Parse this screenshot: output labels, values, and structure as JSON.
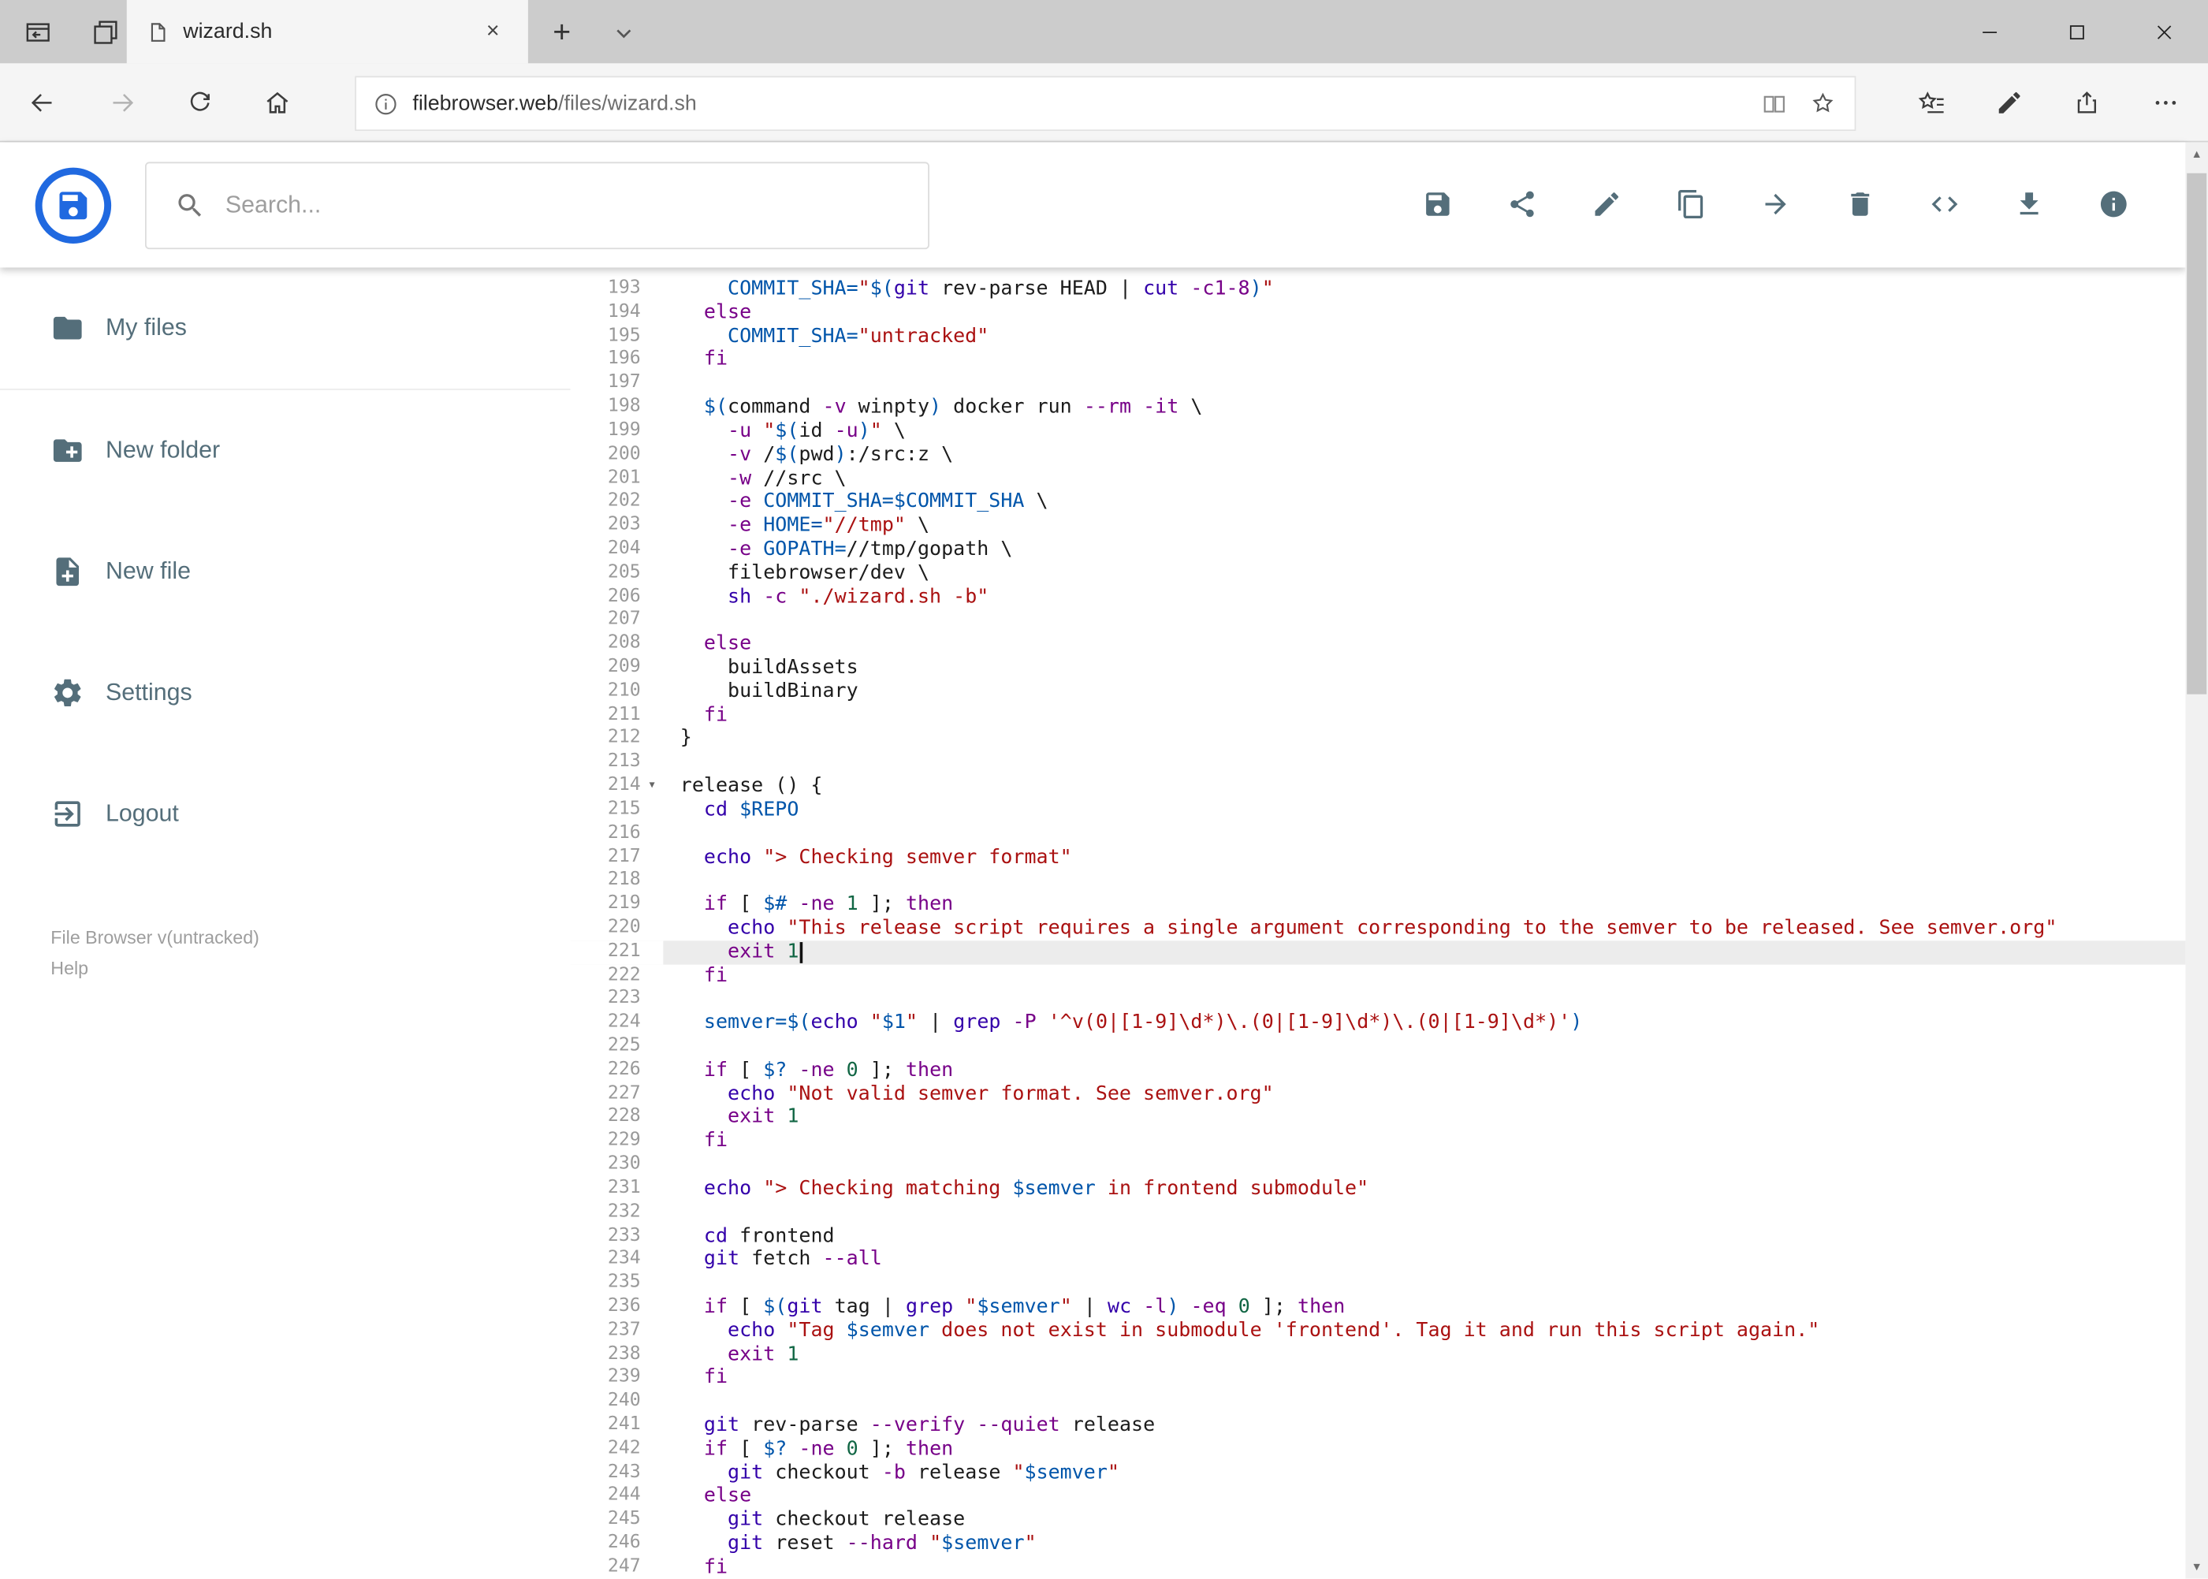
{
  "browser": {
    "tab": {
      "title": "wizard.sh"
    },
    "url": {
      "domain": "filebrowser.web",
      "path": "/files/wizard.sh"
    }
  },
  "header": {
    "search": {
      "placeholder": "Search..."
    },
    "actions": [
      "save-icon",
      "share-icon",
      "edit-icon",
      "copy-icon",
      "move-icon",
      "delete-icon",
      "code-icon",
      "download-icon",
      "info-icon"
    ]
  },
  "sidebar": {
    "items": [
      {
        "label": "My files",
        "icon": "folder-icon"
      },
      {
        "label": "New folder",
        "icon": "new-folder-icon"
      },
      {
        "label": "New file",
        "icon": "new-file-icon"
      },
      {
        "label": "Settings",
        "icon": "settings-gear-icon"
      },
      {
        "label": "Logout",
        "icon": "logout-icon"
      }
    ],
    "footer": {
      "version": "File Browser v(untracked)",
      "help": "Help"
    }
  },
  "colors": {
    "accent": "#2069e0",
    "icon": "#546e7a",
    "syntax": {
      "keyword": "#770088",
      "builtin": "#3300aa",
      "string": "#aa1111",
      "variable": "#0055aa",
      "number": "#116644"
    }
  },
  "editor": {
    "first_line": 193,
    "last_line": 247,
    "active_line": 221,
    "lines": [
      {
        "n": 193,
        "t": [
          [
            "p",
            "    "
          ],
          [
            "v",
            "COMMIT_SHA="
          ],
          [
            "s",
            "\""
          ],
          [
            "v",
            "$("
          ],
          [
            "b",
            "git"
          ],
          [
            "p",
            " rev-parse HEAD | "
          ],
          [
            "b",
            "cut"
          ],
          [
            "p",
            " "
          ],
          [
            "k",
            "-c1-8"
          ],
          [
            "v",
            ")"
          ],
          [
            "s",
            "\""
          ]
        ]
      },
      {
        "n": 194,
        "t": [
          [
            "p",
            "  "
          ],
          [
            "k",
            "else"
          ]
        ]
      },
      {
        "n": 195,
        "t": [
          [
            "p",
            "    "
          ],
          [
            "v",
            "COMMIT_SHA="
          ],
          [
            "s",
            "\"untracked\""
          ]
        ]
      },
      {
        "n": 196,
        "t": [
          [
            "p",
            "  "
          ],
          [
            "k",
            "fi"
          ]
        ]
      },
      {
        "n": 197,
        "t": []
      },
      {
        "n": 198,
        "t": [
          [
            "p",
            "  "
          ],
          [
            "v",
            "$("
          ],
          [
            "p",
            "command "
          ],
          [
            "k",
            "-v"
          ],
          [
            "p",
            " winpty"
          ],
          [
            "v",
            ")"
          ],
          [
            "p",
            " docker run "
          ],
          [
            "k",
            "--rm"
          ],
          [
            "p",
            " "
          ],
          [
            "k",
            "-it"
          ],
          [
            "p",
            " \\"
          ]
        ]
      },
      {
        "n": 199,
        "t": [
          [
            "p",
            "    "
          ],
          [
            "k",
            "-u"
          ],
          [
            "p",
            " "
          ],
          [
            "s",
            "\""
          ],
          [
            "v",
            "$("
          ],
          [
            "p",
            "id "
          ],
          [
            "k",
            "-u"
          ],
          [
            "v",
            ")"
          ],
          [
            "s",
            "\""
          ],
          [
            "p",
            " \\"
          ]
        ]
      },
      {
        "n": 200,
        "t": [
          [
            "p",
            "    "
          ],
          [
            "k",
            "-v"
          ],
          [
            "p",
            " /"
          ],
          [
            "v",
            "$("
          ],
          [
            "p",
            "pwd"
          ],
          [
            "v",
            ")"
          ],
          [
            "p",
            ":/src:z \\"
          ]
        ]
      },
      {
        "n": 201,
        "t": [
          [
            "p",
            "    "
          ],
          [
            "k",
            "-w"
          ],
          [
            "p",
            " //src \\"
          ]
        ]
      },
      {
        "n": 202,
        "t": [
          [
            "p",
            "    "
          ],
          [
            "k",
            "-e"
          ],
          [
            "p",
            " "
          ],
          [
            "v",
            "COMMIT_SHA=$COMMIT_SHA"
          ],
          [
            "p",
            " \\"
          ]
        ]
      },
      {
        "n": 203,
        "t": [
          [
            "p",
            "    "
          ],
          [
            "k",
            "-e"
          ],
          [
            "p",
            " "
          ],
          [
            "v",
            "HOME="
          ],
          [
            "s",
            "\"//tmp\""
          ],
          [
            "p",
            " \\"
          ]
        ]
      },
      {
        "n": 204,
        "t": [
          [
            "p",
            "    "
          ],
          [
            "k",
            "-e"
          ],
          [
            "p",
            " "
          ],
          [
            "v",
            "GOPATH="
          ],
          [
            "p",
            "//tmp/gopath \\"
          ]
        ]
      },
      {
        "n": 205,
        "t": [
          [
            "p",
            "    filebrowser/dev \\"
          ]
        ]
      },
      {
        "n": 206,
        "t": [
          [
            "p",
            "    "
          ],
          [
            "b",
            "sh"
          ],
          [
            "p",
            " "
          ],
          [
            "k",
            "-c"
          ],
          [
            "p",
            " "
          ],
          [
            "s",
            "\"./wizard.sh -b\""
          ]
        ]
      },
      {
        "n": 207,
        "t": []
      },
      {
        "n": 208,
        "t": [
          [
            "p",
            "  "
          ],
          [
            "k",
            "else"
          ]
        ]
      },
      {
        "n": 209,
        "t": [
          [
            "p",
            "    buildAssets"
          ]
        ]
      },
      {
        "n": 210,
        "t": [
          [
            "p",
            "    buildBinary"
          ]
        ]
      },
      {
        "n": 211,
        "t": [
          [
            "p",
            "  "
          ],
          [
            "k",
            "fi"
          ]
        ]
      },
      {
        "n": 212,
        "t": [
          [
            "p",
            "}"
          ]
        ]
      },
      {
        "n": 213,
        "t": []
      },
      {
        "n": 214,
        "fold": true,
        "t": [
          [
            "p",
            "release () {"
          ]
        ]
      },
      {
        "n": 215,
        "t": [
          [
            "p",
            "  "
          ],
          [
            "b",
            "cd"
          ],
          [
            "p",
            " "
          ],
          [
            "v",
            "$REPO"
          ]
        ]
      },
      {
        "n": 216,
        "t": []
      },
      {
        "n": 217,
        "t": [
          [
            "p",
            "  "
          ],
          [
            "b",
            "echo"
          ],
          [
            "p",
            " "
          ],
          [
            "s",
            "\"> Checking semver format\""
          ]
        ]
      },
      {
        "n": 218,
        "t": []
      },
      {
        "n": 219,
        "t": [
          [
            "p",
            "  "
          ],
          [
            "k",
            "if"
          ],
          [
            "p",
            " [ "
          ],
          [
            "v",
            "$#"
          ],
          [
            "p",
            " "
          ],
          [
            "k",
            "-ne"
          ],
          [
            "p",
            " "
          ],
          [
            "n",
            "1"
          ],
          [
            "p",
            " ]; "
          ],
          [
            "k",
            "then"
          ]
        ]
      },
      {
        "n": 220,
        "t": [
          [
            "p",
            "    "
          ],
          [
            "b",
            "echo"
          ],
          [
            "p",
            " "
          ],
          [
            "s",
            "\"This release script requires a single argument corresponding to the semver to be released. See semver.org\""
          ]
        ]
      },
      {
        "n": 221,
        "active": true,
        "cursor": true,
        "t": [
          [
            "p",
            "    "
          ],
          [
            "k",
            "exit"
          ],
          [
            "p",
            " "
          ],
          [
            "n",
            "1"
          ]
        ]
      },
      {
        "n": 222,
        "t": [
          [
            "p",
            "  "
          ],
          [
            "k",
            "fi"
          ]
        ]
      },
      {
        "n": 223,
        "t": []
      },
      {
        "n": 224,
        "t": [
          [
            "p",
            "  "
          ],
          [
            "v",
            "semver="
          ],
          [
            "v",
            "$("
          ],
          [
            "b",
            "echo"
          ],
          [
            "p",
            " "
          ],
          [
            "s",
            "\""
          ],
          [
            "v",
            "$1"
          ],
          [
            "s",
            "\""
          ],
          [
            "p",
            " | "
          ],
          [
            "b",
            "grep"
          ],
          [
            "p",
            " "
          ],
          [
            "k",
            "-P"
          ],
          [
            "p",
            " "
          ],
          [
            "s",
            "'^v(0|[1-9]\\d*)\\.(0|[1-9]\\d*)\\.(0|[1-9]\\d*)'"
          ],
          [
            "v",
            ")"
          ]
        ]
      },
      {
        "n": 225,
        "t": []
      },
      {
        "n": 226,
        "t": [
          [
            "p",
            "  "
          ],
          [
            "k",
            "if"
          ],
          [
            "p",
            " [ "
          ],
          [
            "v",
            "$?"
          ],
          [
            "p",
            " "
          ],
          [
            "k",
            "-ne"
          ],
          [
            "p",
            " "
          ],
          [
            "n",
            "0"
          ],
          [
            "p",
            " ]; "
          ],
          [
            "k",
            "then"
          ]
        ]
      },
      {
        "n": 227,
        "t": [
          [
            "p",
            "    "
          ],
          [
            "b",
            "echo"
          ],
          [
            "p",
            " "
          ],
          [
            "s",
            "\"Not valid semver format. See semver.org\""
          ]
        ]
      },
      {
        "n": 228,
        "t": [
          [
            "p",
            "    "
          ],
          [
            "k",
            "exit"
          ],
          [
            "p",
            " "
          ],
          [
            "n",
            "1"
          ]
        ]
      },
      {
        "n": 229,
        "t": [
          [
            "p",
            "  "
          ],
          [
            "k",
            "fi"
          ]
        ]
      },
      {
        "n": 230,
        "t": []
      },
      {
        "n": 231,
        "t": [
          [
            "p",
            "  "
          ],
          [
            "b",
            "echo"
          ],
          [
            "p",
            " "
          ],
          [
            "s",
            "\"> Checking matching "
          ],
          [
            "v",
            "$semver"
          ],
          [
            "s",
            " in frontend submodule\""
          ]
        ]
      },
      {
        "n": 232,
        "t": []
      },
      {
        "n": 233,
        "t": [
          [
            "p",
            "  "
          ],
          [
            "b",
            "cd"
          ],
          [
            "p",
            " frontend"
          ]
        ]
      },
      {
        "n": 234,
        "t": [
          [
            "p",
            "  "
          ],
          [
            "b",
            "git"
          ],
          [
            "p",
            " fetch "
          ],
          [
            "k",
            "--all"
          ]
        ]
      },
      {
        "n": 235,
        "t": []
      },
      {
        "n": 236,
        "t": [
          [
            "p",
            "  "
          ],
          [
            "k",
            "if"
          ],
          [
            "p",
            " [ "
          ],
          [
            "v",
            "$("
          ],
          [
            "b",
            "git"
          ],
          [
            "p",
            " tag | "
          ],
          [
            "b",
            "grep"
          ],
          [
            "p",
            " "
          ],
          [
            "s",
            "\""
          ],
          [
            "v",
            "$semver"
          ],
          [
            "s",
            "\""
          ],
          [
            "p",
            " | "
          ],
          [
            "b",
            "wc"
          ],
          [
            "p",
            " "
          ],
          [
            "k",
            "-l"
          ],
          [
            "v",
            ")"
          ],
          [
            "p",
            " "
          ],
          [
            "k",
            "-eq"
          ],
          [
            "p",
            " "
          ],
          [
            "n",
            "0"
          ],
          [
            "p",
            " ]; "
          ],
          [
            "k",
            "then"
          ]
        ]
      },
      {
        "n": 237,
        "t": [
          [
            "p",
            "    "
          ],
          [
            "b",
            "echo"
          ],
          [
            "p",
            " "
          ],
          [
            "s",
            "\"Tag "
          ],
          [
            "v",
            "$semver"
          ],
          [
            "s",
            " does not exist in submodule 'frontend'. Tag it and run this script again.\""
          ]
        ]
      },
      {
        "n": 238,
        "t": [
          [
            "p",
            "    "
          ],
          [
            "k",
            "exit"
          ],
          [
            "p",
            " "
          ],
          [
            "n",
            "1"
          ]
        ]
      },
      {
        "n": 239,
        "t": [
          [
            "p",
            "  "
          ],
          [
            "k",
            "fi"
          ]
        ]
      },
      {
        "n": 240,
        "t": []
      },
      {
        "n": 241,
        "t": [
          [
            "p",
            "  "
          ],
          [
            "b",
            "git"
          ],
          [
            "p",
            " rev-parse "
          ],
          [
            "k",
            "--verify"
          ],
          [
            "p",
            " "
          ],
          [
            "k",
            "--quiet"
          ],
          [
            "p",
            " release"
          ]
        ]
      },
      {
        "n": 242,
        "t": [
          [
            "p",
            "  "
          ],
          [
            "k",
            "if"
          ],
          [
            "p",
            " [ "
          ],
          [
            "v",
            "$?"
          ],
          [
            "p",
            " "
          ],
          [
            "k",
            "-ne"
          ],
          [
            "p",
            " "
          ],
          [
            "n",
            "0"
          ],
          [
            "p",
            " ]; "
          ],
          [
            "k",
            "then"
          ]
        ]
      },
      {
        "n": 243,
        "t": [
          [
            "p",
            "    "
          ],
          [
            "b",
            "git"
          ],
          [
            "p",
            " checkout "
          ],
          [
            "k",
            "-b"
          ],
          [
            "p",
            " release "
          ],
          [
            "s",
            "\""
          ],
          [
            "v",
            "$semver"
          ],
          [
            "s",
            "\""
          ]
        ]
      },
      {
        "n": 244,
        "t": [
          [
            "p",
            "  "
          ],
          [
            "k",
            "else"
          ]
        ]
      },
      {
        "n": 245,
        "t": [
          [
            "p",
            "    "
          ],
          [
            "b",
            "git"
          ],
          [
            "p",
            " checkout release"
          ]
        ]
      },
      {
        "n": 246,
        "t": [
          [
            "p",
            "    "
          ],
          [
            "b",
            "git"
          ],
          [
            "p",
            " reset "
          ],
          [
            "k",
            "--hard"
          ],
          [
            "p",
            " "
          ],
          [
            "s",
            "\""
          ],
          [
            "v",
            "$semver"
          ],
          [
            "s",
            "\""
          ]
        ]
      },
      {
        "n": 247,
        "t": [
          [
            "p",
            "  "
          ],
          [
            "k",
            "fi"
          ]
        ]
      }
    ]
  }
}
